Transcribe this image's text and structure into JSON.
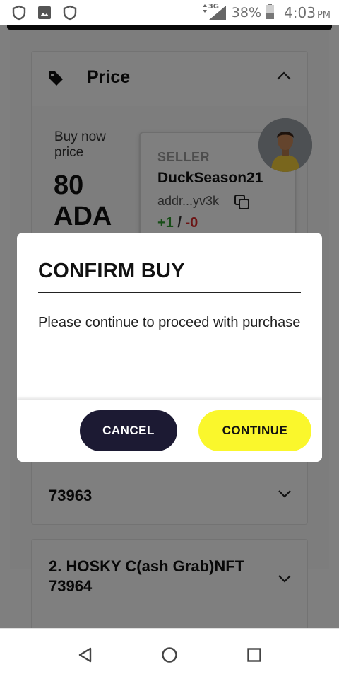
{
  "status_bar": {
    "icons": [
      "shield-icon",
      "image-icon",
      "shield-icon",
      "network-signal-icon",
      "battery-icon"
    ],
    "network": "3G",
    "battery": "38%",
    "time": "4:03",
    "ampm": "PM"
  },
  "price_section": {
    "title": "Price",
    "buy_now_label": "Buy now price",
    "amount_line1": "80",
    "amount_line2": "ADA"
  },
  "seller": {
    "label": "SELLER",
    "name": "DuckSeason21",
    "address": "addr...yv3k",
    "rating_positive": "+1",
    "rating_separator": "/",
    "rating_negative": "-0"
  },
  "nft_list": [
    {
      "title_line1": "",
      "title_line2": "73963"
    },
    {
      "title_line1": "2. HOSKY C(ash Grab)NFT",
      "title_line2": "73964"
    }
  ],
  "dialog": {
    "title": "CONFIRM BUY",
    "message": "Please continue to proceed with purchase",
    "cancel_label": "CANCEL",
    "continue_label": "CONTINUE"
  },
  "colors": {
    "cancel_button": "#1c1a33",
    "continue_button": "#faf72c",
    "positive": "#2e9b2e",
    "negative": "#d92b2b"
  },
  "nav_bar": {
    "icons": [
      "back-icon",
      "home-icon",
      "recents-icon"
    ]
  }
}
